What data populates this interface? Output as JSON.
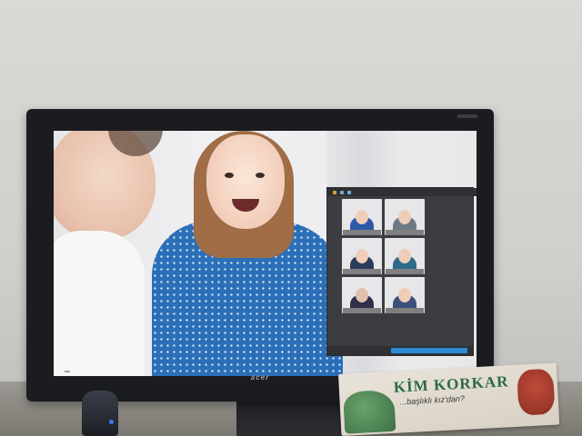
{
  "monitor": {
    "brand": "acer"
  },
  "book": {
    "title": "KİM KORKAR",
    "subtitle": "...başlıklı kız'dan?"
  },
  "colors": {
    "shirt_blue": "#2a6fb8",
    "hair_brown": "#a06d47",
    "book_green": "#2c6a45",
    "zoom_blue": "#2d8ad8"
  }
}
